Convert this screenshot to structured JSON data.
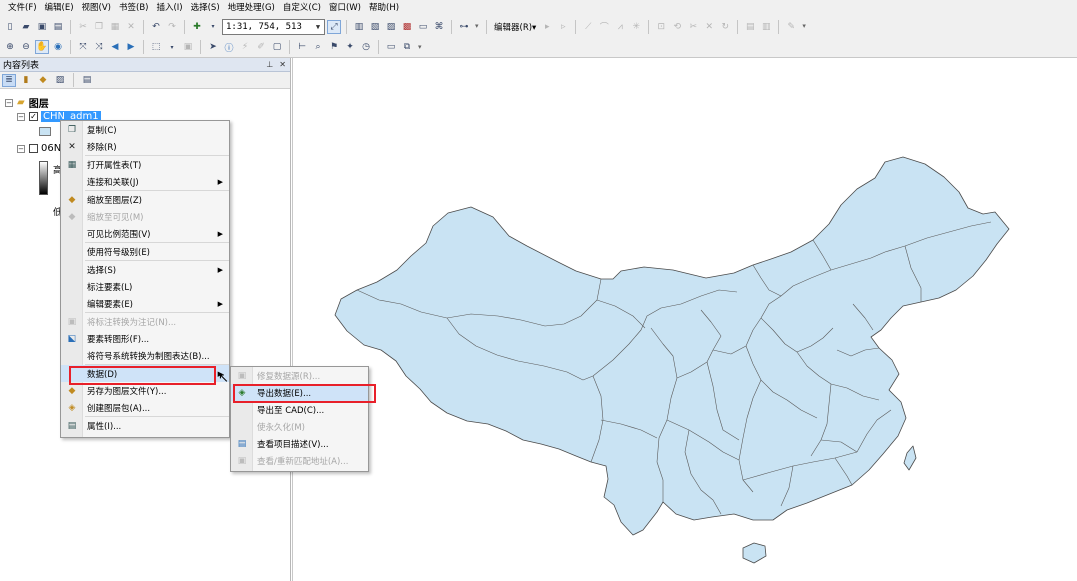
{
  "menubar": [
    "文件(F)",
    "编辑(E)",
    "视图(V)",
    "书签(B)",
    "插入(I)",
    "选择(S)",
    "地理处理(G)",
    "自定义(C)",
    "窗口(W)",
    "帮助(H)"
  ],
  "toolbar": {
    "scale_value": "1:31, 754, 513",
    "editor_label": "编辑器(R)▾"
  },
  "toc": {
    "title": "内容列表",
    "root_label": "图层",
    "layer1_name": "CHN_adm1",
    "layer2_name": "06N",
    "legend_high": "高",
    "legend_low": "低"
  },
  "context_menu": {
    "items": [
      {
        "icon": "copy-icon",
        "label": "复制(C)",
        "enabled": true,
        "submenu": false
      },
      {
        "icon": "remove-icon",
        "label": "移除(R)",
        "enabled": true,
        "submenu": false
      },
      {
        "icon": "table-icon",
        "label": "打开属性表(T)",
        "enabled": true,
        "submenu": false
      },
      {
        "icon": "",
        "label": "连接和关联(J)",
        "enabled": true,
        "submenu": true
      },
      {
        "icon": "zoom-layer-icon",
        "label": "缩放至图层(Z)",
        "enabled": true,
        "submenu": false
      },
      {
        "icon": "zoom-visible-icon",
        "label": "缩放至可见(M)",
        "enabled": false,
        "submenu": false
      },
      {
        "icon": "",
        "label": "可见比例范围(V)",
        "enabled": true,
        "submenu": true
      },
      {
        "icon": "",
        "label": "使用符号级别(E)",
        "enabled": true,
        "submenu": false
      },
      {
        "icon": "",
        "label": "选择(S)",
        "enabled": true,
        "submenu": true
      },
      {
        "icon": "",
        "label": "标注要素(L)",
        "enabled": true,
        "submenu": false
      },
      {
        "icon": "",
        "label": "编辑要素(E)",
        "enabled": true,
        "submenu": true
      },
      {
        "icon": "annotation-icon",
        "label": "将标注转换为注记(N)...",
        "enabled": false,
        "submenu": false
      },
      {
        "icon": "feature-graphic-icon",
        "label": "要素转图形(F)...",
        "enabled": true,
        "submenu": false
      },
      {
        "icon": "",
        "label": "将符号系统转换为制图表达(B)...",
        "enabled": true,
        "submenu": false
      },
      {
        "icon": "",
        "label": "数据(D)",
        "enabled": true,
        "submenu": true
      },
      {
        "icon": "save-layer-icon",
        "label": "另存为图层文件(Y)...",
        "enabled": true,
        "submenu": false
      },
      {
        "icon": "layer-package-icon",
        "label": "创建图层包(A)...",
        "enabled": true,
        "submenu": false
      },
      {
        "icon": "properties-icon",
        "label": "属性(I)...",
        "enabled": true,
        "submenu": false
      }
    ]
  },
  "data_submenu": {
    "items": [
      {
        "icon": "repair-source-icon",
        "label": "修复数据源(R)...",
        "enabled": false
      },
      {
        "icon": "export-data-icon",
        "label": "导出数据(E)...",
        "enabled": true
      },
      {
        "icon": "",
        "label": "导出至 CAD(C)...",
        "enabled": true
      },
      {
        "icon": "",
        "label": "使永久化(M)",
        "enabled": false
      },
      {
        "icon": "metadata-icon",
        "label": "查看项目描述(V)...",
        "enabled": true
      },
      {
        "icon": "rematch-address-icon",
        "label": "查看/重新匹配地址(A)...",
        "enabled": false
      }
    ]
  },
  "colors": {
    "map_fill": "#c9e3f3",
    "map_stroke": "#4a4a4a",
    "highlight_box": "#e8202a",
    "selection": "#3399ff"
  }
}
